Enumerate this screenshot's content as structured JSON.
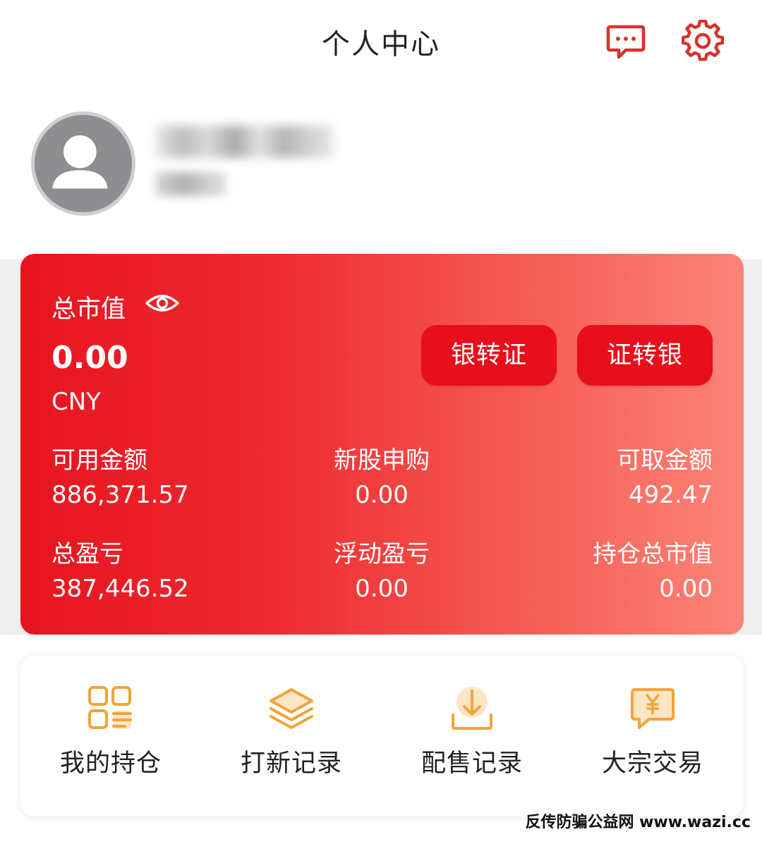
{
  "header": {
    "title": "个人中心",
    "icons": {
      "message": "message-icon",
      "settings": "gear-icon"
    }
  },
  "profile": {
    "avatar_icon": "user-avatar-icon",
    "name_blurred": true
  },
  "asset_card": {
    "total_label": "总市值",
    "visibility_icon": "eye-icon",
    "total_value": "0.00",
    "currency": "CNY",
    "buttons": {
      "bank_to_securities": "银转证",
      "securities_to_bank": "证转银"
    },
    "stats": [
      {
        "label": "可用金额",
        "value": "886,371.57"
      },
      {
        "label": "新股申购",
        "value": "0.00"
      },
      {
        "label": "可取金额",
        "value": "492.47"
      },
      {
        "label": "总盈亏",
        "value": "387,446.52"
      },
      {
        "label": "浮动盈亏",
        "value": "0.00"
      },
      {
        "label": "持仓总市值",
        "value": "0.00"
      }
    ],
    "colors": {
      "gradient_start": "#e81420",
      "gradient_end": "#fc8478",
      "button_bg": "#e80e1c"
    }
  },
  "menu": {
    "items": [
      {
        "label": "我的持仓",
        "icon": "holdings-grid-icon"
      },
      {
        "label": "打新记录",
        "icon": "layers-icon"
      },
      {
        "label": "配售记录",
        "icon": "download-tray-icon"
      },
      {
        "label": "大宗交易",
        "icon": "yuan-chat-icon"
      }
    ],
    "icon_color": "#f0a43a"
  },
  "watermark": "反传防骗公益网 www.wazi.cc"
}
